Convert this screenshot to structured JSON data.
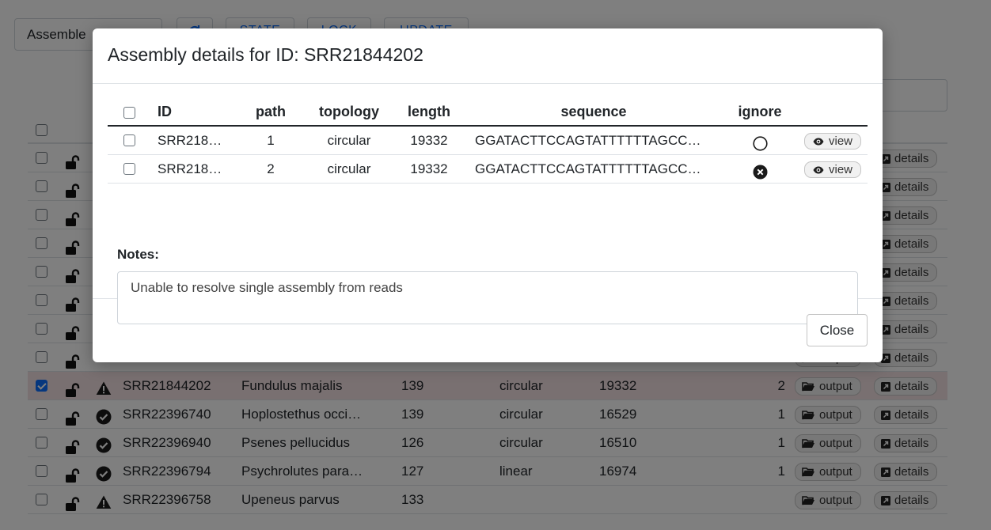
{
  "toolbar": {
    "select_value": "Assemble",
    "buttons": [
      "STATE",
      "LOCK",
      "UPDATE"
    ]
  },
  "table": {
    "rows": [
      {
        "checked": false,
        "status": "",
        "id": "",
        "name": "",
        "path": "",
        "topology": "",
        "length": "",
        "count": "",
        "show_output": false
      },
      {
        "checked": false,
        "status": "",
        "id": "",
        "name": "",
        "path": "",
        "topology": "",
        "length": "",
        "count": "",
        "show_output": false
      },
      {
        "checked": false,
        "status": "",
        "id": "",
        "name": "",
        "path": "",
        "topology": "",
        "length": "",
        "count": "",
        "show_output": false
      },
      {
        "checked": false,
        "status": "",
        "id": "",
        "name": "",
        "path": "",
        "topology": "",
        "length": "",
        "count": "",
        "show_output": false
      },
      {
        "checked": false,
        "status": "",
        "id": "",
        "name": "",
        "path": "",
        "topology": "",
        "length": "",
        "count": "",
        "show_output": false
      },
      {
        "checked": false,
        "status": "",
        "id": "",
        "name": "",
        "path": "",
        "topology": "",
        "length": "",
        "count": "",
        "show_output": false
      },
      {
        "checked": false,
        "status": "",
        "id": "",
        "name": "",
        "path": "",
        "topology": "",
        "length": "",
        "count": "",
        "show_output": false
      },
      {
        "checked": false,
        "status": "",
        "id": "",
        "name": "",
        "path": "",
        "topology": "",
        "length": "",
        "count": "",
        "show_output": true
      },
      {
        "checked": true,
        "status": "warning",
        "id": "SRR21844202",
        "name": "Fundulus majalis",
        "path": "139",
        "topology": "circular",
        "length": "19332",
        "count": "2",
        "show_output": true
      },
      {
        "checked": false,
        "status": "ok",
        "id": "SRR22396740",
        "name": "Hoplostethus occi…",
        "path": "139",
        "topology": "circular",
        "length": "16529",
        "count": "1",
        "show_output": true
      },
      {
        "checked": false,
        "status": "ok",
        "id": "SRR22396940",
        "name": "Psenes pellucidus",
        "path": "126",
        "topology": "circular",
        "length": "16510",
        "count": "1",
        "show_output": true
      },
      {
        "checked": false,
        "status": "ok",
        "id": "SRR22396794",
        "name": "Psychrolutes para…",
        "path": "127",
        "topology": "linear",
        "length": "16974",
        "count": "1",
        "show_output": true
      },
      {
        "checked": false,
        "status": "warning",
        "id": "SRR22396758",
        "name": "Upeneus parvus",
        "path": "133",
        "topology": "",
        "length": "",
        "count": "",
        "show_output": true
      }
    ],
    "output_label": "output",
    "details_label": "details"
  },
  "modal": {
    "title": "Assembly details for ID: SRR21844202",
    "headers": {
      "id": "ID",
      "path": "path",
      "topology": "topology",
      "length": "length",
      "sequence": "sequence",
      "ignore": "ignore"
    },
    "rows": [
      {
        "id": "SRR218…",
        "path": "1",
        "topology": "circular",
        "length": "19332",
        "sequence": "GGATACTTCCAGTATTTTTTAGCC…",
        "ignored": false
      },
      {
        "id": "SRR218…",
        "path": "2",
        "topology": "circular",
        "length": "19332",
        "sequence": "GGATACTTCCAGTATTTTTTAGCC…",
        "ignored": true
      }
    ],
    "view_label": "view",
    "notes_label": "Notes:",
    "notes_value": "Unable to resolve single assembly from reads",
    "close_label": "Close"
  }
}
